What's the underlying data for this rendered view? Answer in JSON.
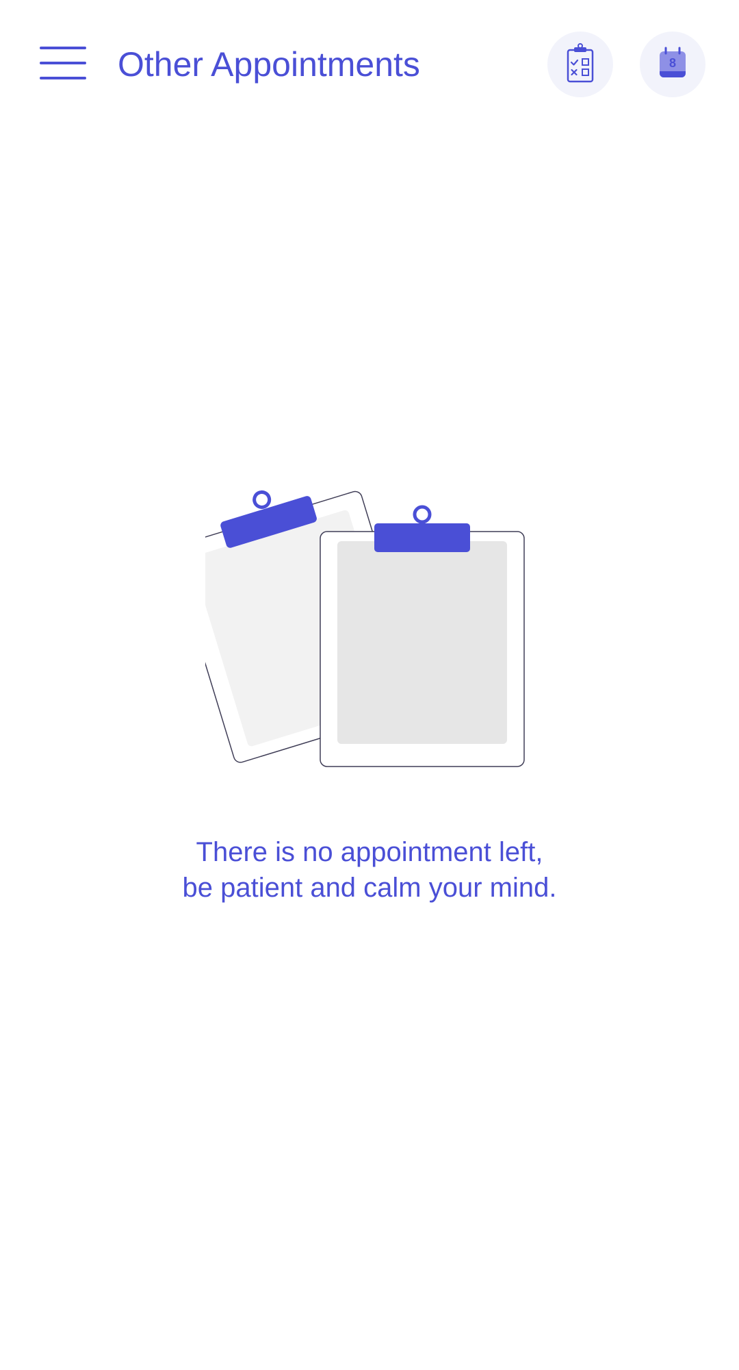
{
  "header": {
    "title": "Other Appointments",
    "menu_icon": "hamburger-menu-icon",
    "checklist_icon": "clipboard-checklist-icon",
    "calendar_icon": "calendar-icon",
    "calendar_day": "8"
  },
  "empty_state": {
    "illustration_icon": "empty-clipboards-icon",
    "line1": "There is no appointment left,",
    "line2": "be patient and calm your mind."
  },
  "colors": {
    "accent": "#4a4fd6",
    "button_bg": "#f2f3fb",
    "paper_light": "#f2f2f2",
    "paper_dark": "#e6e6e6",
    "outline": "#3f3d56"
  }
}
